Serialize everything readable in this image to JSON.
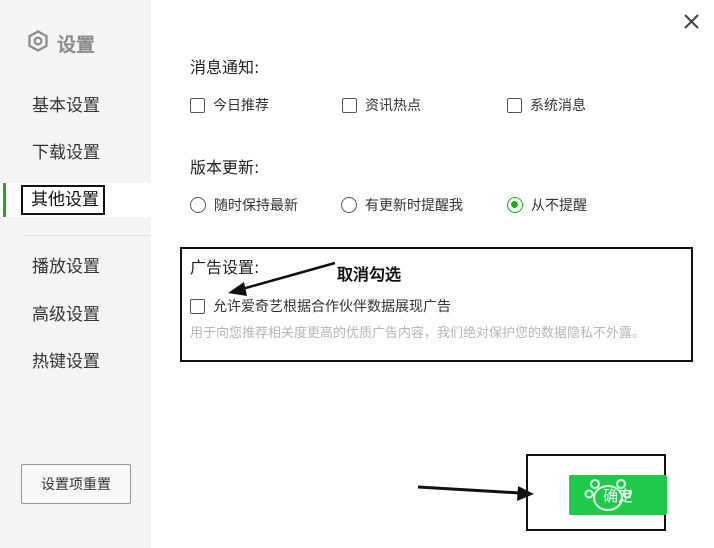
{
  "sidebar": {
    "title": "设置",
    "items": [
      {
        "label": "基本设置",
        "active": false
      },
      {
        "label": "下载设置",
        "active": false
      },
      {
        "label": "其他设置",
        "active": true
      },
      {
        "label": "播放设置",
        "active": false
      },
      {
        "label": "高级设置",
        "active": false
      },
      {
        "label": "热键设置",
        "active": false
      }
    ],
    "reset_label": "设置项重置"
  },
  "notifications": {
    "title": "消息通知:",
    "options": [
      {
        "label": "今日推荐",
        "checked": false
      },
      {
        "label": "资讯热点",
        "checked": false
      },
      {
        "label": "系统消息",
        "checked": false
      }
    ]
  },
  "update": {
    "title": "版本更新:",
    "options": [
      {
        "label": "随时保持最新",
        "selected": false
      },
      {
        "label": "有更新时提醒我",
        "selected": false
      },
      {
        "label": "从不提醒",
        "selected": true
      }
    ]
  },
  "ads": {
    "title": "广告设置:",
    "option_label": "允许爱奇艺根据合作伙伴数据展现广告",
    "option_checked": false,
    "description": "用于向您推荐相关度更高的优质广告内容，我们绝对保护您的数据隐私不外露。"
  },
  "annotation": {
    "text": "取消勾选"
  },
  "confirm_label": "确定",
  "colors": {
    "accent": "#1aad19",
    "confirm": "#1ec94b",
    "sidebar_bg": "#f4f4f4"
  },
  "icons": {
    "header": "gear-hexagon-icon",
    "close": "close-icon"
  }
}
